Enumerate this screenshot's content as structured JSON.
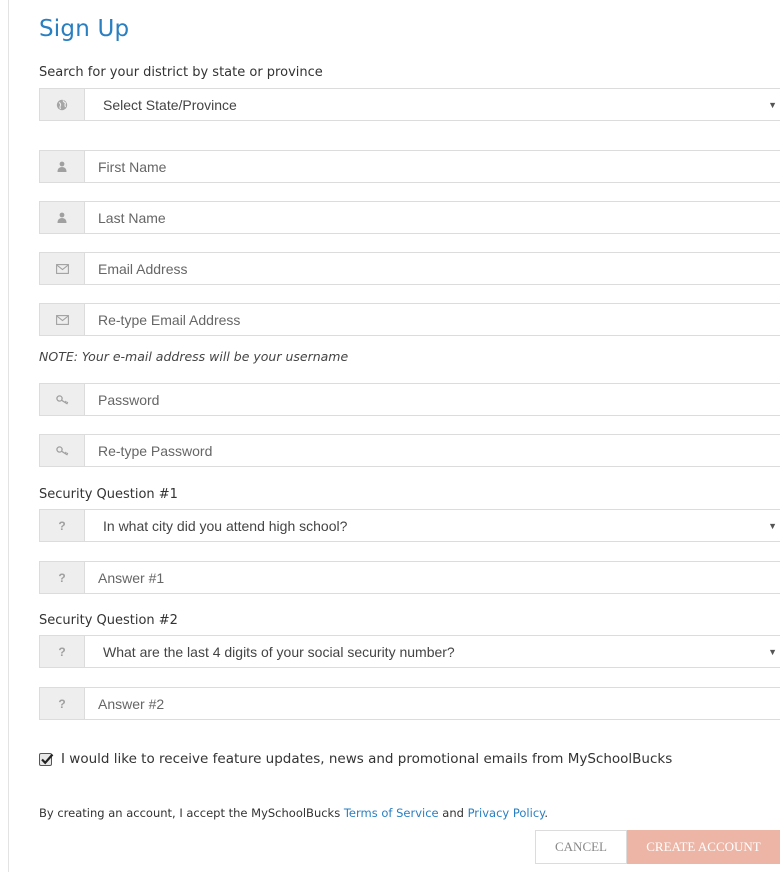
{
  "title": "Sign Up",
  "district": {
    "label": "Search for your district by state or province",
    "select_value": "Select State/Province",
    "icon": "globe-icon"
  },
  "fields": {
    "first_name": {
      "placeholder": "First Name",
      "icon": "user-icon"
    },
    "last_name": {
      "placeholder": "Last Name",
      "icon": "user-icon"
    },
    "email": {
      "placeholder": "Email Address",
      "icon": "envelope-icon"
    },
    "email_confirm": {
      "placeholder": "Re-type Email Address",
      "icon": "envelope-icon"
    },
    "password": {
      "placeholder": "Password",
      "icon": "key-icon"
    },
    "password_confirm": {
      "placeholder": "Re-type Password",
      "icon": "key-icon"
    }
  },
  "note": "NOTE: Your e-mail address will be your username",
  "security1": {
    "label": "Security Question #1",
    "icon_text": "?",
    "question": "In what city did you attend high school?",
    "answer_placeholder": "Answer #1"
  },
  "security2": {
    "label": "Security Question #2",
    "icon_text": "?",
    "question": "What are the last 4 digits of your social security number?",
    "answer_placeholder": "Answer #2"
  },
  "caret": "▼",
  "promo": {
    "checked": true,
    "label": "I would like to receive feature updates, news and promotional emails from MySchoolBucks"
  },
  "terms": {
    "prefix": "By creating an account, I accept the MySchoolBucks ",
    "tos": "Terms of Service",
    "and": " and ",
    "privacy": "Privacy Policy",
    "suffix": "."
  },
  "buttons": {
    "cancel": "CANCEL",
    "create": "CREATE ACCOUNT"
  },
  "colors": {
    "accent": "#2a7fc1",
    "create_button": "#ecb5a6"
  }
}
